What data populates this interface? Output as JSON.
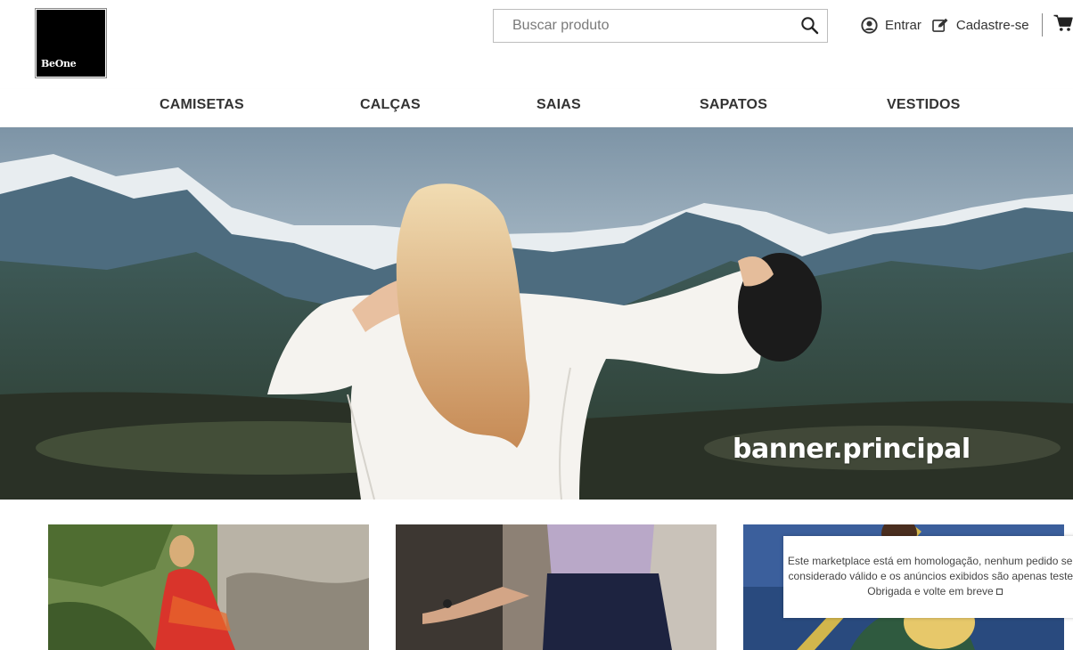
{
  "brand": {
    "logo_text": "BeOne"
  },
  "search": {
    "placeholder": "Buscar produto"
  },
  "account": {
    "login_label": "Entrar",
    "signup_label": "Cadastre-se"
  },
  "nav": {
    "items": [
      {
        "label": "CAMISETAS"
      },
      {
        "label": "CALÇAS"
      },
      {
        "label": "SAIAS"
      },
      {
        "label": "SAPATOS"
      },
      {
        "label": "VESTIDOS"
      }
    ]
  },
  "banner": {
    "caption": "banner.principal"
  },
  "notice": {
    "line1": "Este marketplace está em homologação, nenhum pedido será",
    "line2": "considerado válido e os anúncios exibidos são apenas testes.",
    "line3": "Obrigada e volte em breve"
  },
  "colors": {
    "text": "#333333",
    "header_bg": "#ffffff",
    "logo_bg": "#000000"
  },
  "icons": {
    "search": "search-icon",
    "user": "user-circle-icon",
    "edit": "edit-icon",
    "cart": "cart-icon"
  }
}
